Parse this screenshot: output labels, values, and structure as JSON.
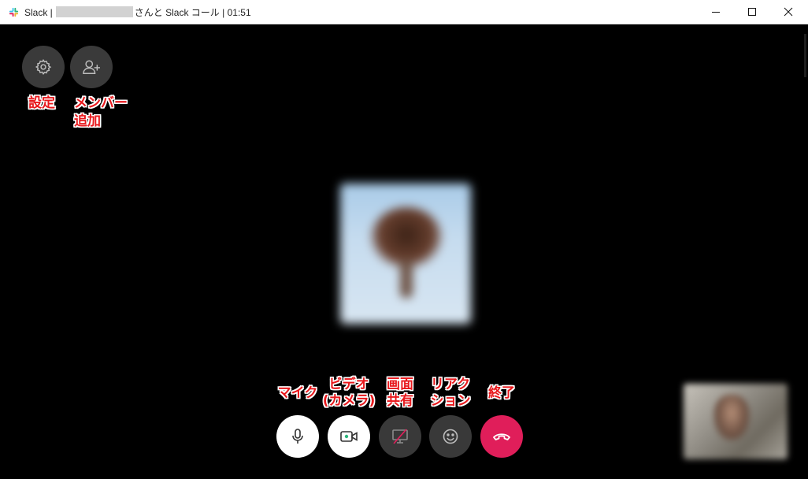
{
  "window": {
    "title_prefix": "Slack |",
    "title_suffix": "さんと Slack コール | 01:51"
  },
  "icons": {
    "app_logo": "slack-logo-icon",
    "minimize": "minimize-icon",
    "maximize": "maximize-icon",
    "close": "close-icon",
    "settings": "gear-icon",
    "add_member": "add-user-icon",
    "mic": "microphone-icon",
    "video": "video-camera-icon",
    "share": "screen-share-off-icon",
    "reaction": "smiley-icon",
    "end": "hang-up-icon"
  },
  "annotations": {
    "settings": "設定",
    "add_member_line1": "メンバー",
    "add_member_line2": "追加",
    "mic": "マイク",
    "video_line1": "ビデオ",
    "video_line2": "(カメラ)",
    "share_line1": "画面",
    "share_line2": "共有",
    "reaction_line1": "リアク",
    "reaction_line2": "ション",
    "end": "終了"
  },
  "colors": {
    "end_call": "#e01e5a",
    "annotation": "#e8181c",
    "dark_button": "#3a3a3a"
  }
}
